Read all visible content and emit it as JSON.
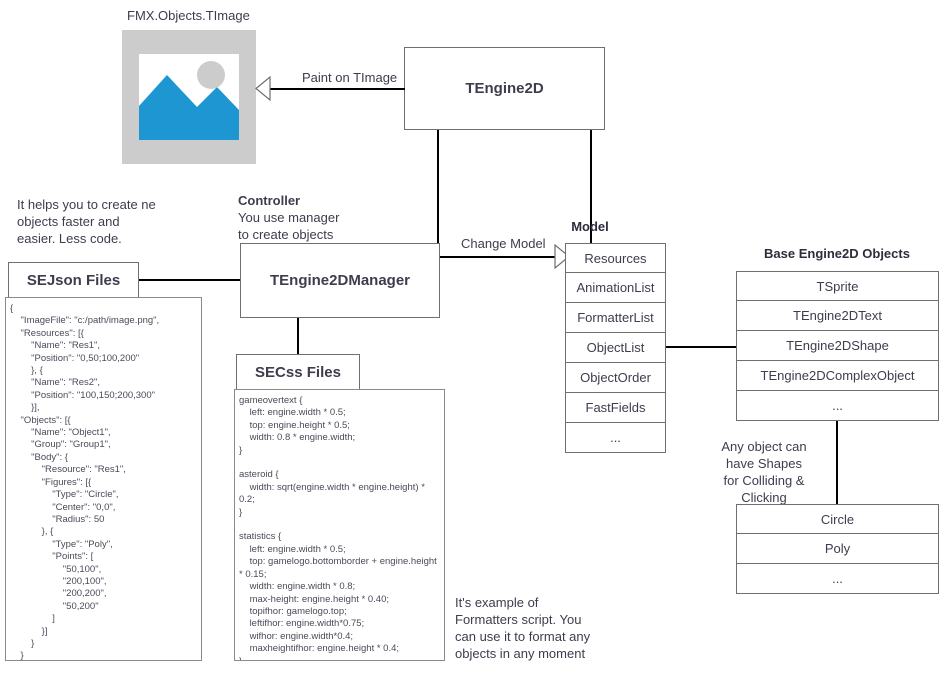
{
  "diagram": {
    "title_image_component": "FMX.Objects.TImage",
    "image_placeholder": {
      "icon": "image-placeholder-icon",
      "frame_color": "#cccccc",
      "photo_color": "#1e96d2",
      "background": "#ffffff"
    },
    "edges": {
      "paint_on_timage": "Paint on TImage",
      "change_model": "Change Model"
    },
    "notes": {
      "sejson_note": "It helps you to create ne\nobjects faster and\neasier. Less code.",
      "controller_note_title": "Controller",
      "controller_note_body": "You use manager\nto create objects",
      "formatters_note": "It's example of\nFormatters script. You\ncan use it to format any\nobjects in any moment",
      "shapes_note": "Any object can\nhave Shapes\nfor Colliding & Clicking"
    },
    "boxes": {
      "engine": "TEngine2D",
      "manager": "TEngine2DManager",
      "sejson_files": "SEJson Files",
      "secss_files": "SECss Files"
    },
    "model": {
      "heading": "Model",
      "items": [
        "Resources",
        "AnimationList",
        "FormatterList",
        "ObjectList",
        "ObjectOrder",
        "FastFields",
        "..."
      ]
    },
    "base_objects": {
      "heading": "Base Engine2D Objects",
      "items": [
        "TSprite",
        "TEngine2DText",
        "TEngine2DShape",
        "TEngine2DComplexObject",
        "..."
      ]
    },
    "shapes": {
      "items": [
        "Circle",
        "Poly",
        "..."
      ]
    },
    "code": {
      "sejson": "{\n    \"ImageFile\": \"c:/path/image.png\",\n    \"Resources\": [{\n        \"Name\": \"Res1\",\n        \"Position\": \"0,50;100,200\"\n        }, {\n        \"Name\": \"Res2\",\n        \"Position\": \"100,150;200,300\"\n        }],\n    \"Objects\": [{\n        \"Name\": \"Object1\",\n        \"Group\": \"Group1\",\n        \"Body\": {\n            \"Resource\": \"Res1\",\n            \"Figures\": [{\n                \"Type\": \"Circle\",\n                \"Center\": \"0,0\",\n                \"Radius\": 50\n            }, {\n                \"Type\": \"Poly\",\n                \"Points\": [\n                    \"50,100\",\n                    \"200,100\",\n                    \"200,200\",\n                    \"50,200\"\n                ]\n            }]\n        }\n    }\n.....",
      "secss": "gameovertext {\n    left: engine.width * 0.5;\n    top: engine.height * 0.5;\n    width: 0.8 * engine.width;\n}\n\nasteroid {\n    width: sqrt(engine.width * engine.height) * 0.2;\n}\n\nstatistics {\n    left: engine.width * 0.5;\n    top: gamelogo.bottomborder + engine.height * 0.15;\n    width: engine.width * 0.8;\n    max-height: engine.height * 0.40;\n    topifhor: gamelogo.top;\n    leftifhor: engine.width*0.75;\n    wifhor: engine.width*0.4;\n    maxheightifhor: engine.height * 0.4;\n}"
    }
  }
}
